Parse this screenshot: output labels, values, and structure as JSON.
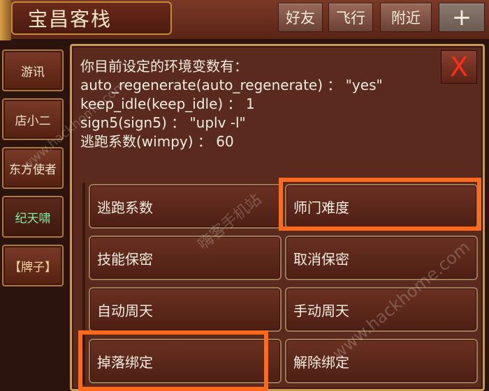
{
  "header": {
    "title": "宝昌客栈",
    "buttons": {
      "friends": "好友",
      "fly": "飞行",
      "nearby": "附近",
      "plus": "+"
    }
  },
  "sidebar": {
    "items": [
      {
        "label": "游讯"
      },
      {
        "label": "店小二"
      },
      {
        "label": "东方使者"
      },
      {
        "label": "纪天啸"
      },
      {
        "label": "【牌子】"
      }
    ]
  },
  "panel": {
    "close": "X",
    "info_lines": [
      "你目前设定的环境变数有：",
      "auto_regenerate(auto_regenerate) ： \"yes\"",
      "keep_idle(keep_idle) ： 1",
      "sign5(sign5) ： \"uplv -l\"",
      "逃跑系数(wimpy) ： 60"
    ],
    "options": [
      {
        "label": "逃跑系数"
      },
      {
        "label": "师门难度"
      },
      {
        "label": "技能保密"
      },
      {
        "label": "取消保密"
      },
      {
        "label": "自动周天"
      },
      {
        "label": "手动周天"
      },
      {
        "label": "掉落绑定"
      },
      {
        "label": "解除绑定"
      }
    ]
  },
  "watermarks": [
    "嗨客手机站",
    "www.hackhome.com",
    "www.hackhome.com"
  ],
  "colors": {
    "highlight": "#ff6a1a",
    "active_label": "#7ff0a4",
    "close_x": "#ff2a1a"
  }
}
